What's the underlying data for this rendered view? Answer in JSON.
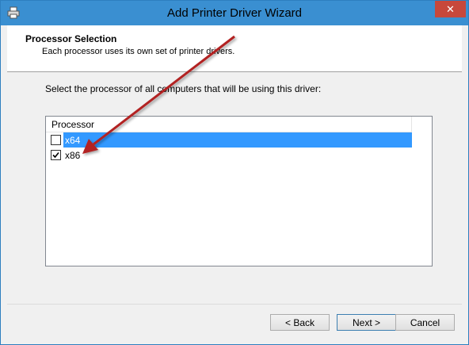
{
  "window": {
    "title": "Add Printer Driver Wizard",
    "close_label": "✕"
  },
  "header": {
    "title": "Processor Selection",
    "subtitle": "Each processor uses its own set of printer drivers."
  },
  "content": {
    "instruction": "Select the processor of all computers that will be using this driver:",
    "list": {
      "column_header": "Processor",
      "items": [
        {
          "label": "x64",
          "checked": false,
          "selected": true
        },
        {
          "label": "x86",
          "checked": true,
          "selected": false
        }
      ]
    }
  },
  "buttons": {
    "back": "< Back",
    "next": "Next >",
    "cancel": "Cancel"
  },
  "colors": {
    "titlebar": "#3a8fd1",
    "close": "#c7483b",
    "selection": "#3399ff",
    "annotation_arrow": "#b22222"
  }
}
